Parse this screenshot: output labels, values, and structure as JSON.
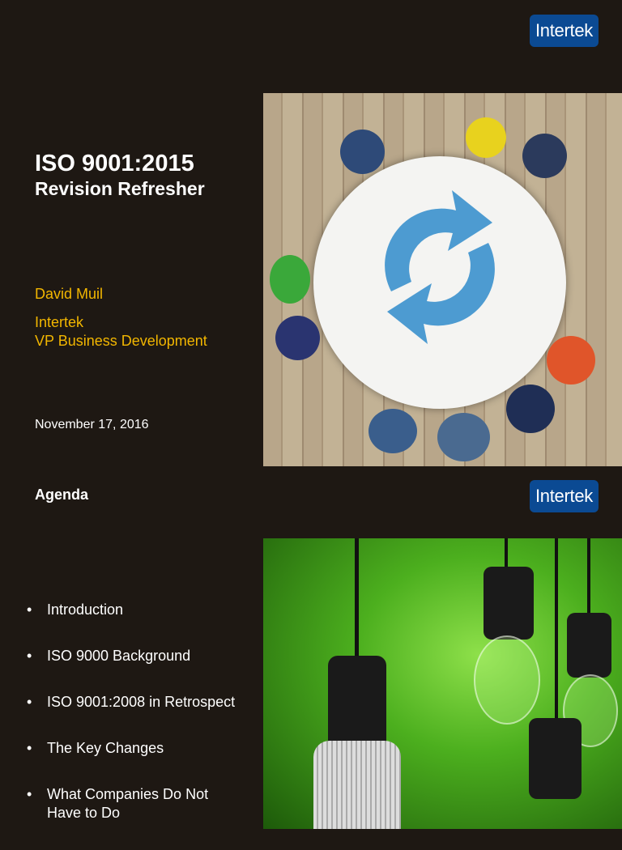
{
  "slide1": {
    "logo": "Intertek",
    "title": "ISO 9001:2015",
    "subtitle": "Revision Refresher",
    "presenter": "David Muil",
    "company": "Intertek",
    "role": "VP Business Development",
    "date": "November 17, 2016",
    "image_icon": "refresh-icon"
  },
  "slide2": {
    "logo": "Intertek",
    "heading": "Agenda",
    "items": [
      "Introduction",
      "ISO 9000 Background",
      "ISO 9001:2008 in Retrospect",
      "The Key Changes",
      "What Companies Do Not Have to Do"
    ]
  },
  "colors": {
    "background": "#1e1813",
    "brand": "#0b4a93",
    "accent": "#f2b600"
  }
}
